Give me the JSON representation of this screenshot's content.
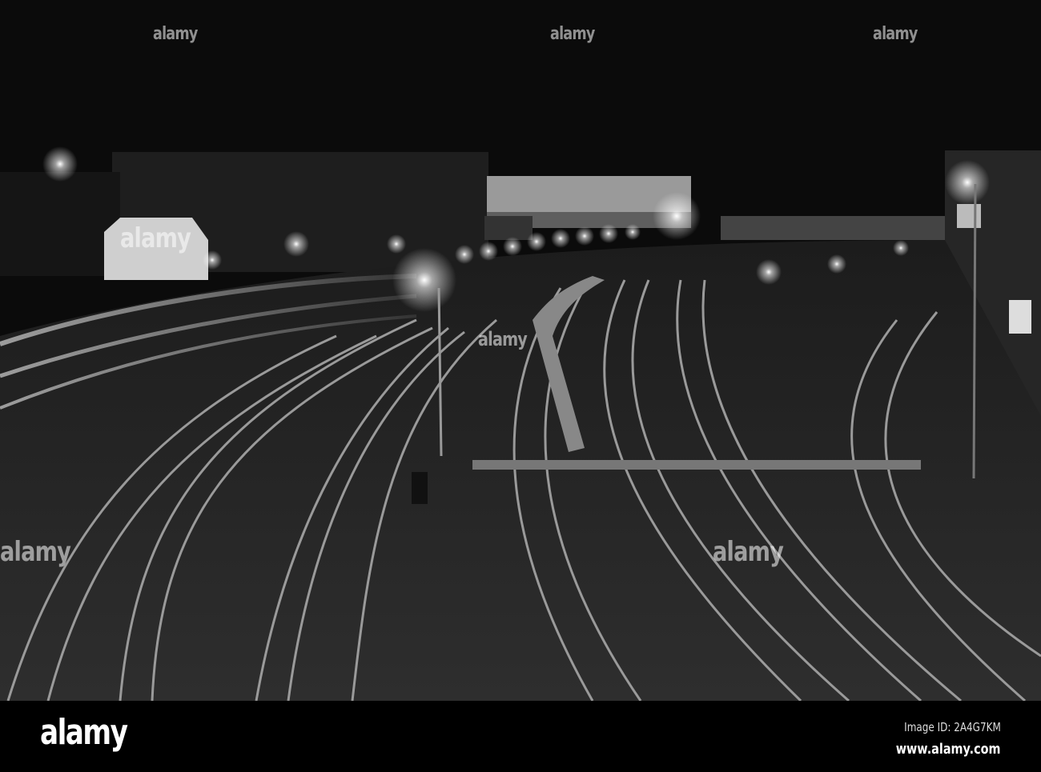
{
  "watermark": {
    "text": "alamy"
  },
  "footer": {
    "logo": "alamy",
    "image_id": "Image ID: 2A4G7KM",
    "url": "www.alamy.com"
  },
  "colors": {
    "sky": "#0b0b0b",
    "ground": "#2a2a2a",
    "light": "#ffffff"
  }
}
